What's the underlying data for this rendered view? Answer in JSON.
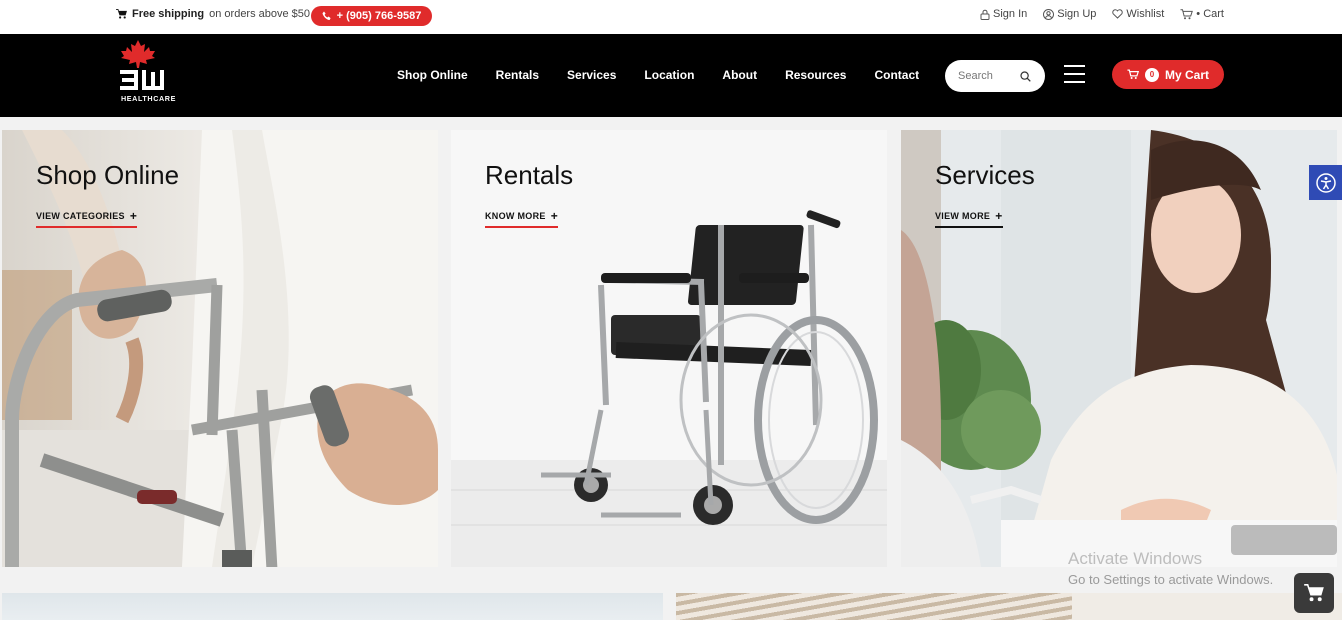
{
  "topbar": {
    "shipping_strong": "Free shipping",
    "shipping_rest": "on orders above $50",
    "phone": "+ (905) 766-9587",
    "links": [
      {
        "label": "Sign In",
        "icon": "lock-icon"
      },
      {
        "label": "Sign Up",
        "icon": "user-icon"
      },
      {
        "label": "Wishlist",
        "icon": "heart-icon"
      },
      {
        "label": "• Cart",
        "icon": "cart-icon"
      }
    ]
  },
  "header": {
    "logo_text": "HEALTHCARE",
    "nav": [
      "Shop Online",
      "Rentals",
      "Services",
      "Location",
      "About",
      "Resources",
      "Contact"
    ],
    "search_placeholder": "Search",
    "cart_count": "0",
    "cart_label": "My Cart"
  },
  "cards": [
    {
      "title": "Shop Online",
      "cta": "VIEW CATEGORIES"
    },
    {
      "title": "Rentals",
      "cta": "KNOW MORE"
    },
    {
      "title": "Services",
      "cta": "VIEW MORE"
    }
  ],
  "overlay": {
    "watermark_line1": "Activate Windows",
    "watermark_line2": "Go to Settings to activate Windows."
  },
  "colors": {
    "accent": "#e02b2b",
    "header_bg": "#000000",
    "accessibility": "#2f4bb5"
  }
}
